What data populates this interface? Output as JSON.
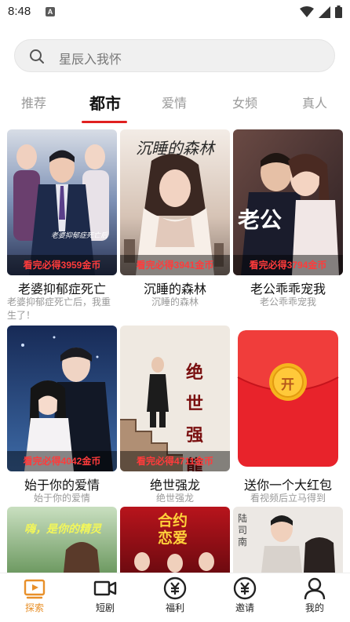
{
  "status_bar": {
    "time": "8:48",
    "notification_icon": "A"
  },
  "search": {
    "placeholder": "星辰入我怀"
  },
  "tabs": [
    {
      "label": "推荐",
      "active": false
    },
    {
      "label": "都市",
      "active": true
    },
    {
      "label": "爱情",
      "active": false
    },
    {
      "label": "女频",
      "active": false
    },
    {
      "label": "真人",
      "active": false
    }
  ],
  "colors": {
    "accent": "#e02020",
    "nav_active": "#e8902a",
    "coin_text": "#ff3b3b",
    "red_envelope": "#e8232b"
  },
  "cards": [
    {
      "title": "老婆抑郁症死亡",
      "subtitle": "老婆抑郁症死亡后，我重生了！",
      "banner": "看完必得3959金币",
      "poster_text": "老婆抑郁症死亡后"
    },
    {
      "title": "沉睡的森林",
      "subtitle": "沉睡的森林",
      "banner": "看完必得3941金币",
      "poster_text": "沉睡的森林"
    },
    {
      "title": "老公乖乖宠我",
      "subtitle": "老公乖乖宠我",
      "banner": "看完必得3794金币",
      "poster_text": "老公"
    },
    {
      "title": "始于你的爱情",
      "subtitle": "始于你的爱情",
      "banner": "看完必得4042金币",
      "poster_text": ""
    },
    {
      "title": "绝世强龙",
      "subtitle": "绝世强龙",
      "banner": "看完必得4711金币",
      "poster_text": "绝世强龍"
    },
    {
      "title": "送你一个大红包",
      "subtitle": "看视频后立马得到",
      "banner": "",
      "poster_text": "开"
    },
    {
      "title": "",
      "subtitle": "",
      "banner": "",
      "poster_text": "嗨，是你的精灵"
    },
    {
      "title": "",
      "subtitle": "",
      "banner": "",
      "poster_text": "合约恋爱"
    },
    {
      "title": "",
      "subtitle": "",
      "banner": "",
      "poster_text": "陆司南"
    }
  ],
  "bottom_nav": [
    {
      "label": "探索",
      "icon": "play-screen-icon",
      "active": true
    },
    {
      "label": "短剧",
      "icon": "video-camera-icon",
      "active": false
    },
    {
      "label": "福利",
      "icon": "yen-coin-icon",
      "active": false
    },
    {
      "label": "邀请",
      "icon": "yen-coin-icon",
      "active": false
    },
    {
      "label": "我的",
      "icon": "person-icon",
      "active": false
    }
  ]
}
